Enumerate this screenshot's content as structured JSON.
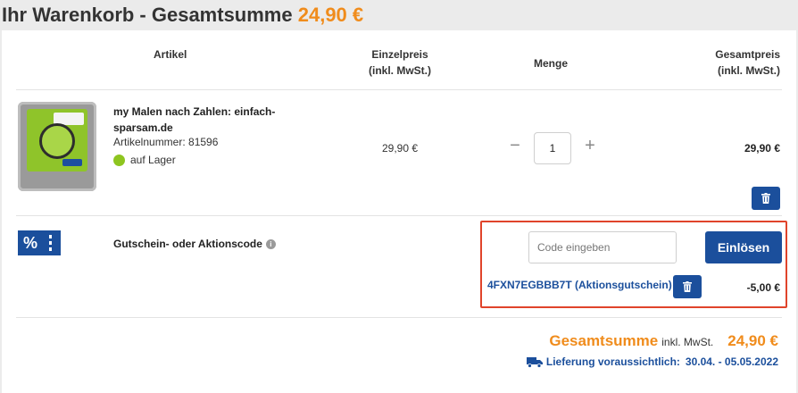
{
  "page": {
    "title": "Ihr Warenkorb - Gesamtsumme",
    "title_total": "24,90 €"
  },
  "table": {
    "headers": {
      "article": "Artikel",
      "unit_price_line1": "Einzelpreis",
      "unit_price_line2": "(inkl. MwSt.)",
      "quantity": "Menge",
      "total_line1": "Gesamtpreis",
      "total_line2": "(inkl. MwSt.)"
    }
  },
  "item": {
    "name": "my Malen nach Zahlen: einfach-sparsam.de",
    "article_number": "Artikelnummer: 81596",
    "stock": "auf Lager",
    "unit_price": "29,90 €",
    "quantity": "1",
    "minus": "−",
    "plus": "+",
    "line_total": "29,90 €"
  },
  "voucher": {
    "label": "Gutschein- oder Aktionscode",
    "icon_text": "%",
    "placeholder": "Code eingeben",
    "redeem_label": "Einlösen",
    "applied_code": "4FXN7EGBBB7T (Aktionsgutschein)",
    "discount": "-5,00 €"
  },
  "summary": {
    "grand_label": "Gesamtsumme",
    "vat_note": "inkl. MwSt.",
    "grand_value": "24,90 €",
    "delivery_label": "Lieferung voraussichtlich:",
    "delivery_dates": "30.04. - 05.05.2022"
  },
  "colors": {
    "accent_orange": "#f08c1c",
    "primary_blue": "#1b4f9c",
    "highlight_red": "#e0442b",
    "stock_green": "#8ec51f"
  },
  "icons": [
    "trash-icon",
    "info-icon",
    "truck-icon",
    "voucher-percent-icon"
  ]
}
